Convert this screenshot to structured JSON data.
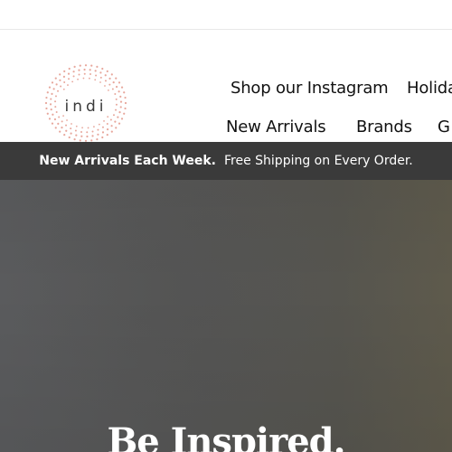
{
  "brand": {
    "logo_text": "indi",
    "logo_dot_color": "#e7a79c",
    "logo_text_color": "#3a3a3a"
  },
  "nav": {
    "top_row": [
      "Shop our Instagram",
      "Holida"
    ],
    "bottom_row": [
      "New Arrivals",
      "Brands",
      "G"
    ]
  },
  "promo": {
    "bold_text": "New Arrivals Each Week.",
    "text": "Free Shipping on Every Order.",
    "background": "#3a3a3a"
  },
  "hero": {
    "title": "Be Inspired."
  }
}
